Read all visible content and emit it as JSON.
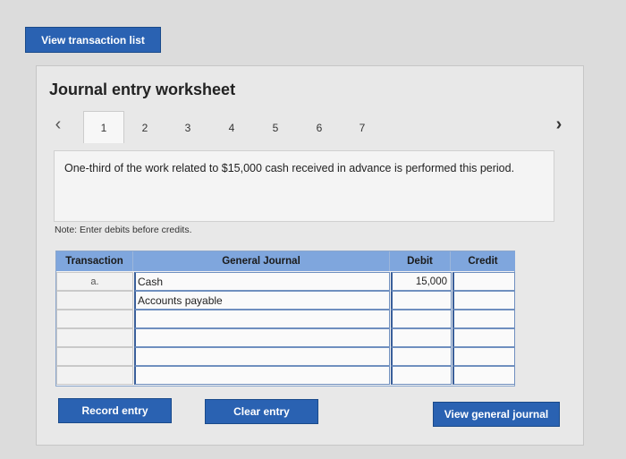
{
  "top": {
    "view_transactions_label": "View transaction list"
  },
  "worksheet": {
    "title": "Journal entry worksheet",
    "tabs": [
      "1",
      "2",
      "3",
      "4",
      "5",
      "6",
      "7"
    ],
    "active_tab": "1",
    "description": "One-third of the work related to $15,000 cash received in advance is performed this period.",
    "note": "Note: Enter debits before credits."
  },
  "table": {
    "headers": {
      "transaction": "Transaction",
      "general_journal": "General Journal",
      "debit": "Debit",
      "credit": "Credit"
    },
    "rows": [
      {
        "transaction": "a.",
        "account": "Cash",
        "debit": "15,000",
        "credit": ""
      },
      {
        "transaction": "",
        "account": "Accounts payable",
        "debit": "",
        "credit": ""
      },
      {
        "transaction": "",
        "account": "",
        "debit": "",
        "credit": ""
      },
      {
        "transaction": "",
        "account": "",
        "debit": "",
        "credit": ""
      },
      {
        "transaction": "",
        "account": "",
        "debit": "",
        "credit": ""
      },
      {
        "transaction": "",
        "account": "",
        "debit": "",
        "credit": ""
      }
    ]
  },
  "buttons": {
    "record": "Record entry",
    "clear": "Clear entry",
    "view_journal": "View general journal"
  },
  "icons": {
    "prev": "chevron-left-icon",
    "next": "chevron-right-icon"
  },
  "colors": {
    "button": "#2a62b2",
    "table_header": "#7fa6dd"
  }
}
